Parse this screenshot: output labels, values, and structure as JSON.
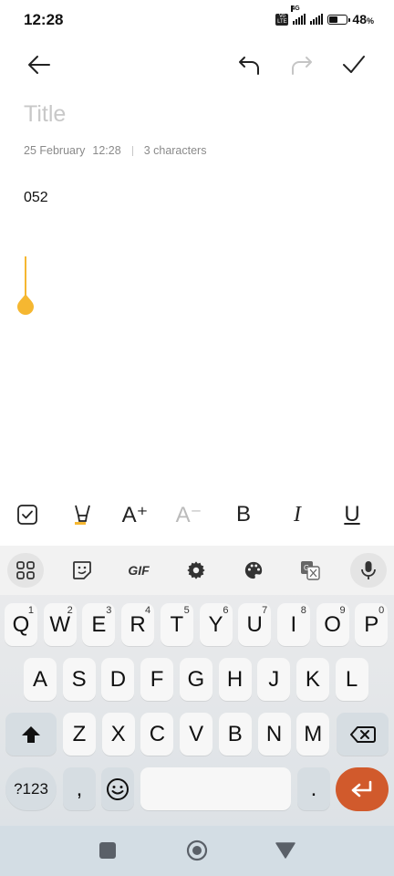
{
  "status": {
    "time": "12:28",
    "net": "4G",
    "volte": "Vo LTE",
    "battery_pct": "48",
    "battery_unit": "%",
    "battery_level": 0.48
  },
  "note": {
    "title_placeholder": "Title",
    "date": "25 February",
    "time": "12:28",
    "char_count": "3 characters",
    "body": "052"
  },
  "format_bar": {
    "font_up": "A⁺",
    "font_down": "A⁻",
    "bold": "B",
    "italic": "I",
    "underline": "U"
  },
  "keyboard": {
    "gif_label": "GIF",
    "row1": [
      {
        "k": "Q",
        "h": "1"
      },
      {
        "k": "W",
        "h": "2"
      },
      {
        "k": "E",
        "h": "3"
      },
      {
        "k": "R",
        "h": "4"
      },
      {
        "k": "T",
        "h": "5"
      },
      {
        "k": "Y",
        "h": "6"
      },
      {
        "k": "U",
        "h": "7"
      },
      {
        "k": "I",
        "h": "8"
      },
      {
        "k": "O",
        "h": "9"
      },
      {
        "k": "P",
        "h": "0"
      }
    ],
    "row2": [
      "A",
      "S",
      "D",
      "F",
      "G",
      "H",
      "J",
      "K",
      "L"
    ],
    "row3": [
      "Z",
      "X",
      "C",
      "V",
      "B",
      "N",
      "M"
    ],
    "symbols_label": "?123",
    "comma": ",",
    "period": "."
  },
  "colors": {
    "accent": "#f5b731",
    "enter": "#d15a2c"
  }
}
